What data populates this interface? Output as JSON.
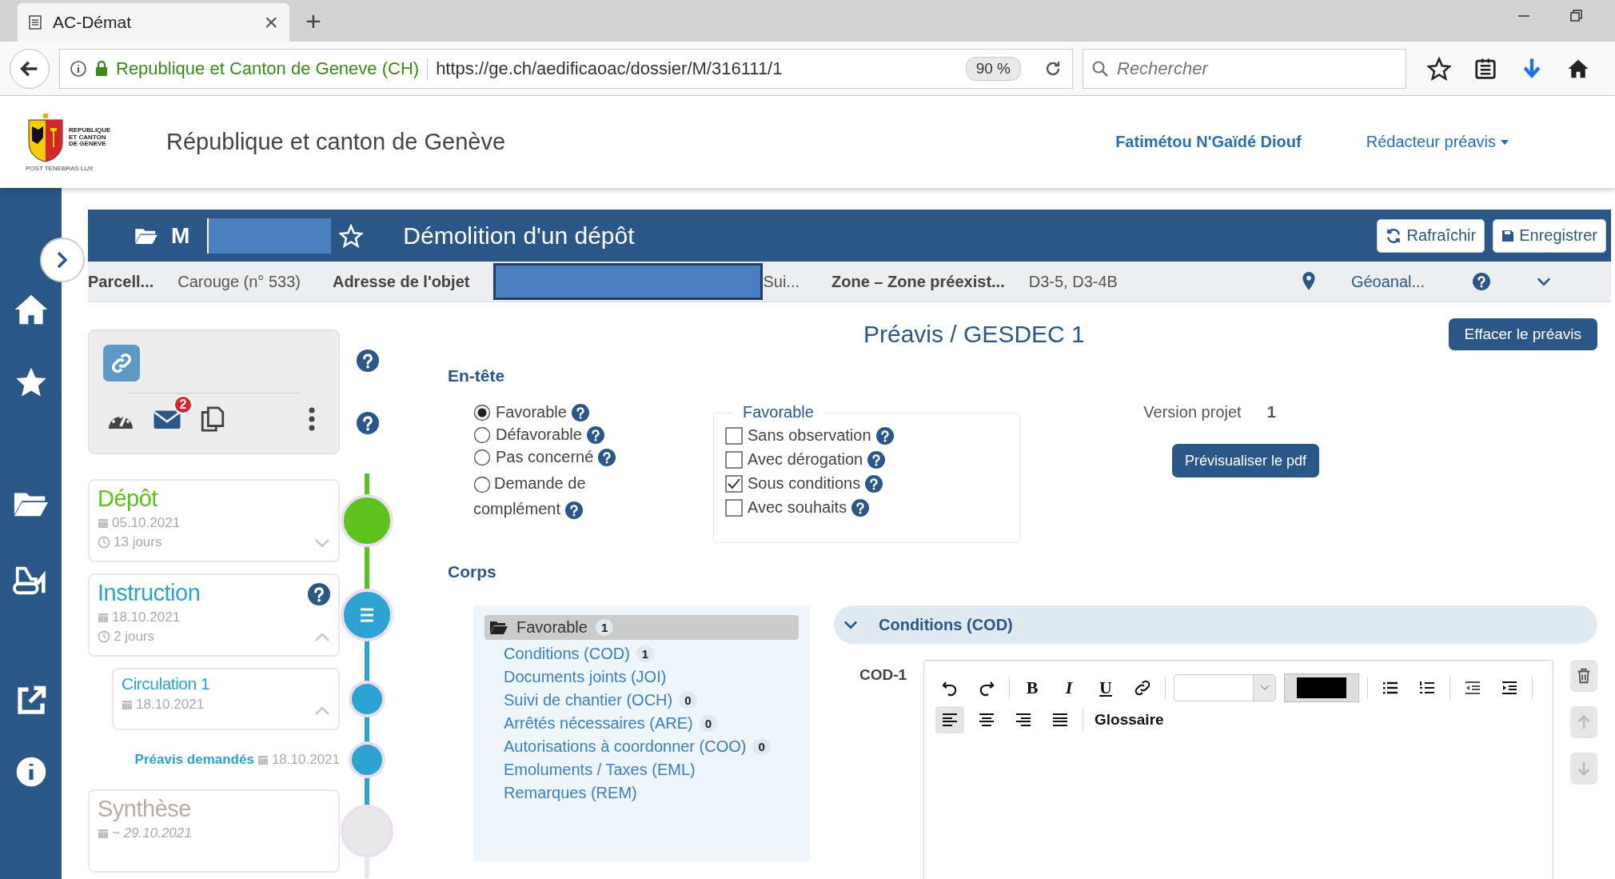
{
  "browser": {
    "tab": {
      "title": "AC-Démat",
      "close": "×"
    },
    "new_tab": "+",
    "identity": "Republique et Canton de Geneve (CH)",
    "url": "https://ge.ch/aedificaoac/dossier/M/316111/1",
    "zoom": "90 %",
    "search": {
      "placeholder": "Rechercher"
    }
  },
  "header": {
    "logo_lines": [
      "REPUBLIQUE",
      "ET CANTON",
      "DE GENEVE"
    ],
    "motto": "POST TENEBRAS LUX",
    "title": "République et canton de Genève",
    "user": "Fatimétou N'Gaïdé Diouf",
    "role": "Rédacteur préavis"
  },
  "dossier": {
    "prefix": "M",
    "favorite": false,
    "title": "Démolition d'un dépôt",
    "buttons": [
      {
        "kind": "refresh",
        "label": "Rafraîchir"
      },
      {
        "kind": "save",
        "label": "Enregistrer"
      }
    ]
  },
  "info_bar": {
    "items": [
      {
        "kind": "label",
        "text": "Parcell..."
      },
      {
        "kind": "value",
        "text": "Carouge (n° 533)"
      },
      {
        "kind": "label",
        "text": "Adresse de l'objet"
      },
      {
        "kind": "redacted"
      },
      {
        "kind": "value",
        "text": "Sui..."
      },
      {
        "kind": "label",
        "text": "Zone – Zone préexist..."
      },
      {
        "kind": "value",
        "text": "D3-5, D3-4B"
      }
    ],
    "geo": "Géoanal..."
  },
  "actions": {
    "mail_count": "2"
  },
  "timeline": [
    {
      "kind": "stage",
      "completed": true,
      "current": false,
      "title": "Dépôt",
      "date": "05.10.2021",
      "duration": "13 jours",
      "expanded": false,
      "help": false
    },
    {
      "kind": "stage",
      "completed": false,
      "current": true,
      "title": "Instruction",
      "date": "18.10.2021",
      "duration": "2 jours",
      "expanded": true,
      "help": true
    },
    {
      "kind": "sub",
      "completed": false,
      "current": true,
      "title": "Circulation 1",
      "date": "18.10.2021",
      "expanded": true
    },
    {
      "kind": "event",
      "completed": false,
      "current": true,
      "title": "Préavis demandés",
      "date": "18.10.2021"
    },
    {
      "kind": "stage",
      "completed": false,
      "current": false,
      "title": "Synthèse",
      "date": "~ 29.10.2021",
      "help": false
    }
  ],
  "preavis": {
    "title": "Préavis / GESDEC 1",
    "erase": "Effacer le préavis",
    "entete": {
      "heading": "En-tête",
      "radios": [
        {
          "label": "Favorable",
          "selected": true
        },
        {
          "label": "Défavorable",
          "selected": false
        },
        {
          "label": "Pas concerné",
          "selected": false
        },
        {
          "label": "Demande de complément",
          "selected": false
        }
      ],
      "legend": "Favorable",
      "checkboxes": [
        {
          "label": "Sans observation",
          "checked": false
        },
        {
          "label": "Avec dérogation",
          "checked": false
        },
        {
          "label": "Sous conditions",
          "checked": true
        },
        {
          "label": "Avec souhaits",
          "checked": false
        }
      ],
      "version_label": "Version projet",
      "version": "1",
      "preview": "Prévisualiser le pdf"
    },
    "corps": {
      "heading": "Corps",
      "tree": {
        "label": "Favorable",
        "count": "1",
        "selected": true,
        "expanded": true,
        "children": [
          {
            "label": "Conditions (COD)",
            "count": "1",
            "selected": false
          },
          {
            "label": "Documents joints (JOI)",
            "selected": false
          },
          {
            "label": "Suivi de chantier (OCH)",
            "count": "0",
            "selected": false
          },
          {
            "label": "Arrêtés nécessaires (ARE)",
            "count": "0",
            "selected": false
          },
          {
            "label": "Autorisations à coordonner (COO)",
            "count": "0",
            "selected": false
          },
          {
            "label": "Emoluments / Taxes (EML)",
            "selected": false
          },
          {
            "label": "Remarques (REM)",
            "selected": false
          }
        ]
      },
      "section": {
        "title": "Conditions (COD)",
        "expanded": true,
        "entry": "COD-1",
        "toolbar": [
          [
            {
              "kind": "undo"
            },
            {
              "kind": "redo"
            },
            {
              "kind": "sep"
            },
            {
              "kind": "bold",
              "label": "B"
            },
            {
              "kind": "italic",
              "label": "I"
            },
            {
              "kind": "underline",
              "label": "U"
            },
            {
              "kind": "link"
            },
            {
              "kind": "sep"
            },
            {
              "kind": "select"
            },
            {
              "kind": "color"
            },
            {
              "kind": "sep"
            },
            {
              "kind": "bullets"
            },
            {
              "kind": "numbers"
            },
            {
              "kind": "sep"
            },
            {
              "kind": "outdent"
            },
            {
              "kind": "indent"
            },
            {
              "kind": "sep"
            }
          ],
          [
            {
              "kind": "align-left",
              "selected": true
            },
            {
              "kind": "align-center",
              "selected": false
            },
            {
              "kind": "align-right",
              "selected": false
            },
            {
              "kind": "align-justify",
              "selected": false
            },
            {
              "kind": "sep"
            },
            {
              "kind": "glossary",
              "label": "Glossaire"
            }
          ]
        ]
      }
    }
  }
}
